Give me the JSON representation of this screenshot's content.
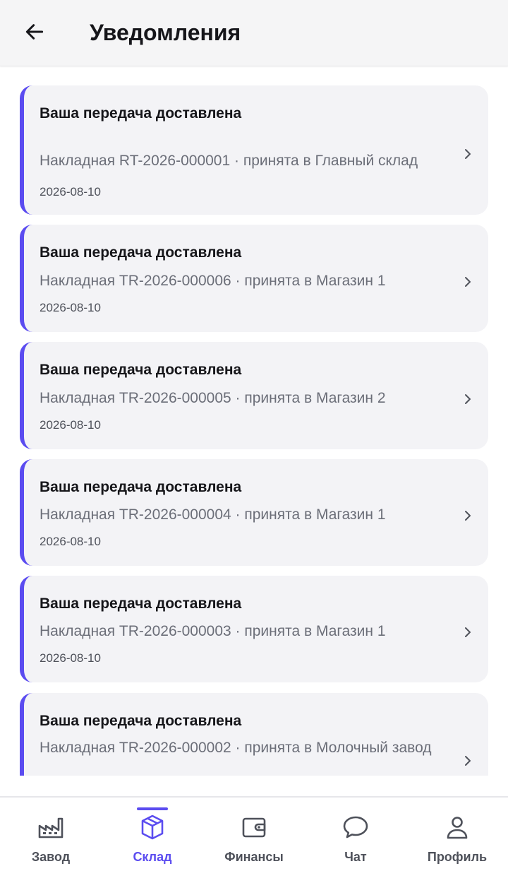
{
  "header": {
    "title": "Уведомления",
    "back_icon": "arrow-left-icon"
  },
  "colors": {
    "accent": "#5b4cf0",
    "card_background": "#f3f3f6",
    "header_background": "#f5f5f6",
    "text_primary": "#16161a",
    "text_secondary": "#6b6e78"
  },
  "notifications": [
    {
      "title": "Ваша передача доставлена",
      "body": "Накладная RT-2026-000001 · принята в Главный склад",
      "date": "2026-08-10"
    },
    {
      "title": "Ваша передача доставлена",
      "body": "Накладная TR-2026-000006 · принята в Магазин 1",
      "date": "2026-08-10"
    },
    {
      "title": "Ваша передача доставлена",
      "body": "Накладная TR-2026-000005 · принята в Магазин 2",
      "date": "2026-08-10"
    },
    {
      "title": "Ваша передача доставлена",
      "body": "Накладная TR-2026-000004 · принята в Магазин 1",
      "date": "2026-08-10"
    },
    {
      "title": "Ваша передача доставлена",
      "body": "Накладная TR-2026-000003 · принята в Магазин 1",
      "date": "2026-08-10"
    },
    {
      "title": "Ваша передача доставлена",
      "body": "Накладная TR-2026-000002 · принята в Молочный завод",
      "date": ""
    }
  ],
  "bottom_nav": {
    "active": "Склад",
    "items": [
      {
        "label": "Завод",
        "icon": "factory-icon"
      },
      {
        "label": "Склад",
        "icon": "box-icon"
      },
      {
        "label": "Финансы",
        "icon": "wallet-icon"
      },
      {
        "label": "Чат",
        "icon": "chat-bubble-icon"
      },
      {
        "label": "Профиль",
        "icon": "user-icon"
      }
    ]
  }
}
